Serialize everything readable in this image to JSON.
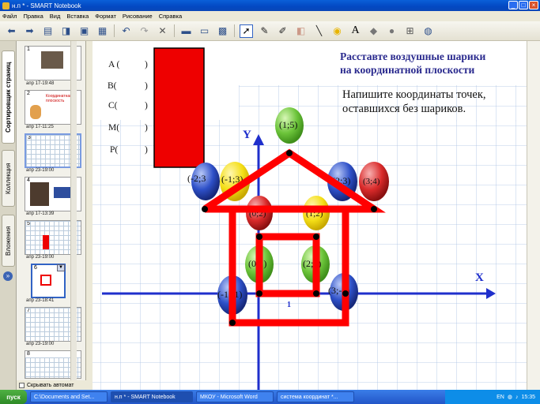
{
  "window": {
    "title": "н.п * - SMART Notebook",
    "min": "_",
    "max": "□",
    "close": "×"
  },
  "menu": [
    "Файл",
    "Правка",
    "Вид",
    "Вставка",
    "Формат",
    "Рисование",
    "Справка"
  ],
  "toolbar_icons": [
    "back-icon",
    "forward-icon",
    "add-page-icon",
    "open-icon",
    "save-icon",
    "paste-icon",
    "undo-icon",
    "redo-icon",
    "delete-icon",
    "screen-shade-icon",
    "full-screen-icon",
    "table-icon",
    "select-icon",
    "pen-icon",
    "highlighter-icon",
    "eraser-icon",
    "line-icon",
    "fill-icon",
    "text-icon",
    "shape-icon",
    "properties-icon",
    "move-toolbar-icon"
  ],
  "sidebar_tabs": [
    "Сортировщик страниц",
    "Коллекция",
    "Вложения"
  ],
  "thumbnails": [
    {
      "num": "1",
      "caption": "апр 17-19:48"
    },
    {
      "num": "2",
      "caption": "апр 17-11:25",
      "text": "Координатная плоскость"
    },
    {
      "num": "3",
      "caption": "апр 23-19:00"
    },
    {
      "num": "4",
      "caption": "апр 17-13:39"
    },
    {
      "num": "5",
      "caption": "апр 23-19:00"
    },
    {
      "num": "6",
      "caption": "апр 23-18:41"
    },
    {
      "num": "7",
      "caption": "апр 23-19:00"
    },
    {
      "num": "8",
      "caption": ""
    }
  ],
  "autohide_label": "Скрывать автомат",
  "page": {
    "heading_line1": "Расставте воздушные шарики",
    "heading_line2": "на координатной плоскости",
    "instruction_line1": "Напишите координаты точек,",
    "instruction_line2": "оставшихся без шариков.",
    "points": [
      "A (",
      "B(",
      "C(",
      "M(",
      "P("
    ],
    "point_closers": [
      ")",
      ")",
      ")",
      ")",
      ")"
    ],
    "axis_x": "X",
    "axis_y": "Y",
    "unit_label": "1",
    "balloons": [
      {
        "label": "(1;5)",
        "color": "green"
      },
      {
        "label": "(-2;3",
        "color": "blue"
      },
      {
        "label": "(-1;3)",
        "color": "yellow"
      },
      {
        "label": "(2;3)",
        "color": "blue"
      },
      {
        "label": "(3;4)",
        "color": "red"
      },
      {
        "label": "(0;2)",
        "color": "red"
      },
      {
        "label": "(1;2)",
        "color": "yellow"
      },
      {
        "label": "(0;1)",
        "color": "green"
      },
      {
        "label": "(2;1)",
        "color": "green"
      },
      {
        "label": "(-1;-1)",
        "color": "blue"
      },
      {
        "label": "(3;-1)",
        "color": "blue"
      }
    ],
    "colors": {
      "house": "#ff0000",
      "axes": "#1f2fcc",
      "grid": "#a9c0e2",
      "heading": "#2a2a8e"
    }
  },
  "taskbar": {
    "start": "пуск",
    "tasks": [
      "C:\\Documents and Set...",
      "н.п * - SMART Notebook",
      "МКОУ - Microsoft Word",
      "система координат *..."
    ],
    "lang": "EN",
    "time": "15:35"
  }
}
